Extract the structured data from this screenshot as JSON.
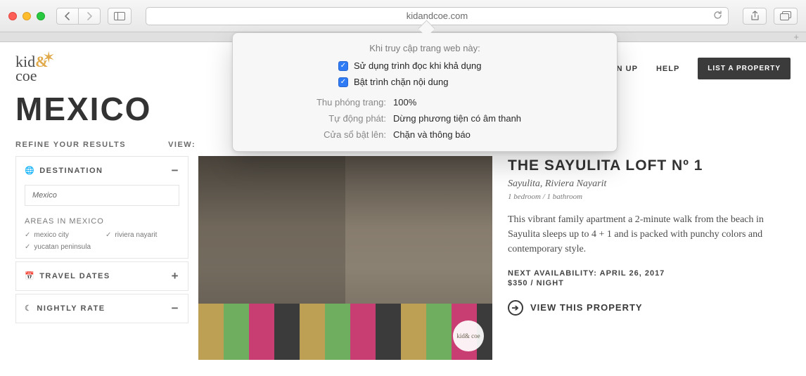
{
  "browser": {
    "url": "kidandcoe.com"
  },
  "popover": {
    "title": "Khi truy cập trang web này:",
    "check1": "Sử dụng trình đọc khi khả dụng",
    "check2": "Bật trình chặn nội dung",
    "zoom_label": "Thu phóng trang:",
    "zoom_value": "100%",
    "autoplay_label": "Tự động phát:",
    "autoplay_value": "Dừng phương tiện có âm thanh",
    "popup_label": "Cửa sổ bật lên:",
    "popup_value": "Chặn và thông báo"
  },
  "nav": {
    "signup": "SIGN UP",
    "help": "HELP",
    "list": "LIST A PROPERTY"
  },
  "page": {
    "country": "MEXICO",
    "refine": "REFINE YOUR RESULTS",
    "view": "VIEW:"
  },
  "filters": {
    "destination": {
      "label": "DESTINATION",
      "value": "Mexico",
      "areas_title": "AREAS IN MEXICO",
      "areas": [
        "mexico city",
        "riviera nayarit",
        "yucatan peninsula"
      ]
    },
    "travel": {
      "label": "TRAVEL DATES"
    },
    "rate": {
      "label": "NIGHTLY RATE"
    }
  },
  "property": {
    "title": "THE SAYULITA LOFT Nº 1",
    "location": "Sayulita, Riviera Nayarit",
    "rooms": "1 bedroom / 1 bathroom",
    "desc": "This vibrant family apartment a 2-minute walk from the beach in Sayulita sleeps up to 4 + 1 and is packed with punchy colors and contemporary style.",
    "avail": "NEXT AVAILABILITY: APRIL 26, 2017",
    "price": "$350 / NIGHT",
    "view": "VIEW THIS PROPERTY",
    "badge": "kid&\ncoe"
  }
}
